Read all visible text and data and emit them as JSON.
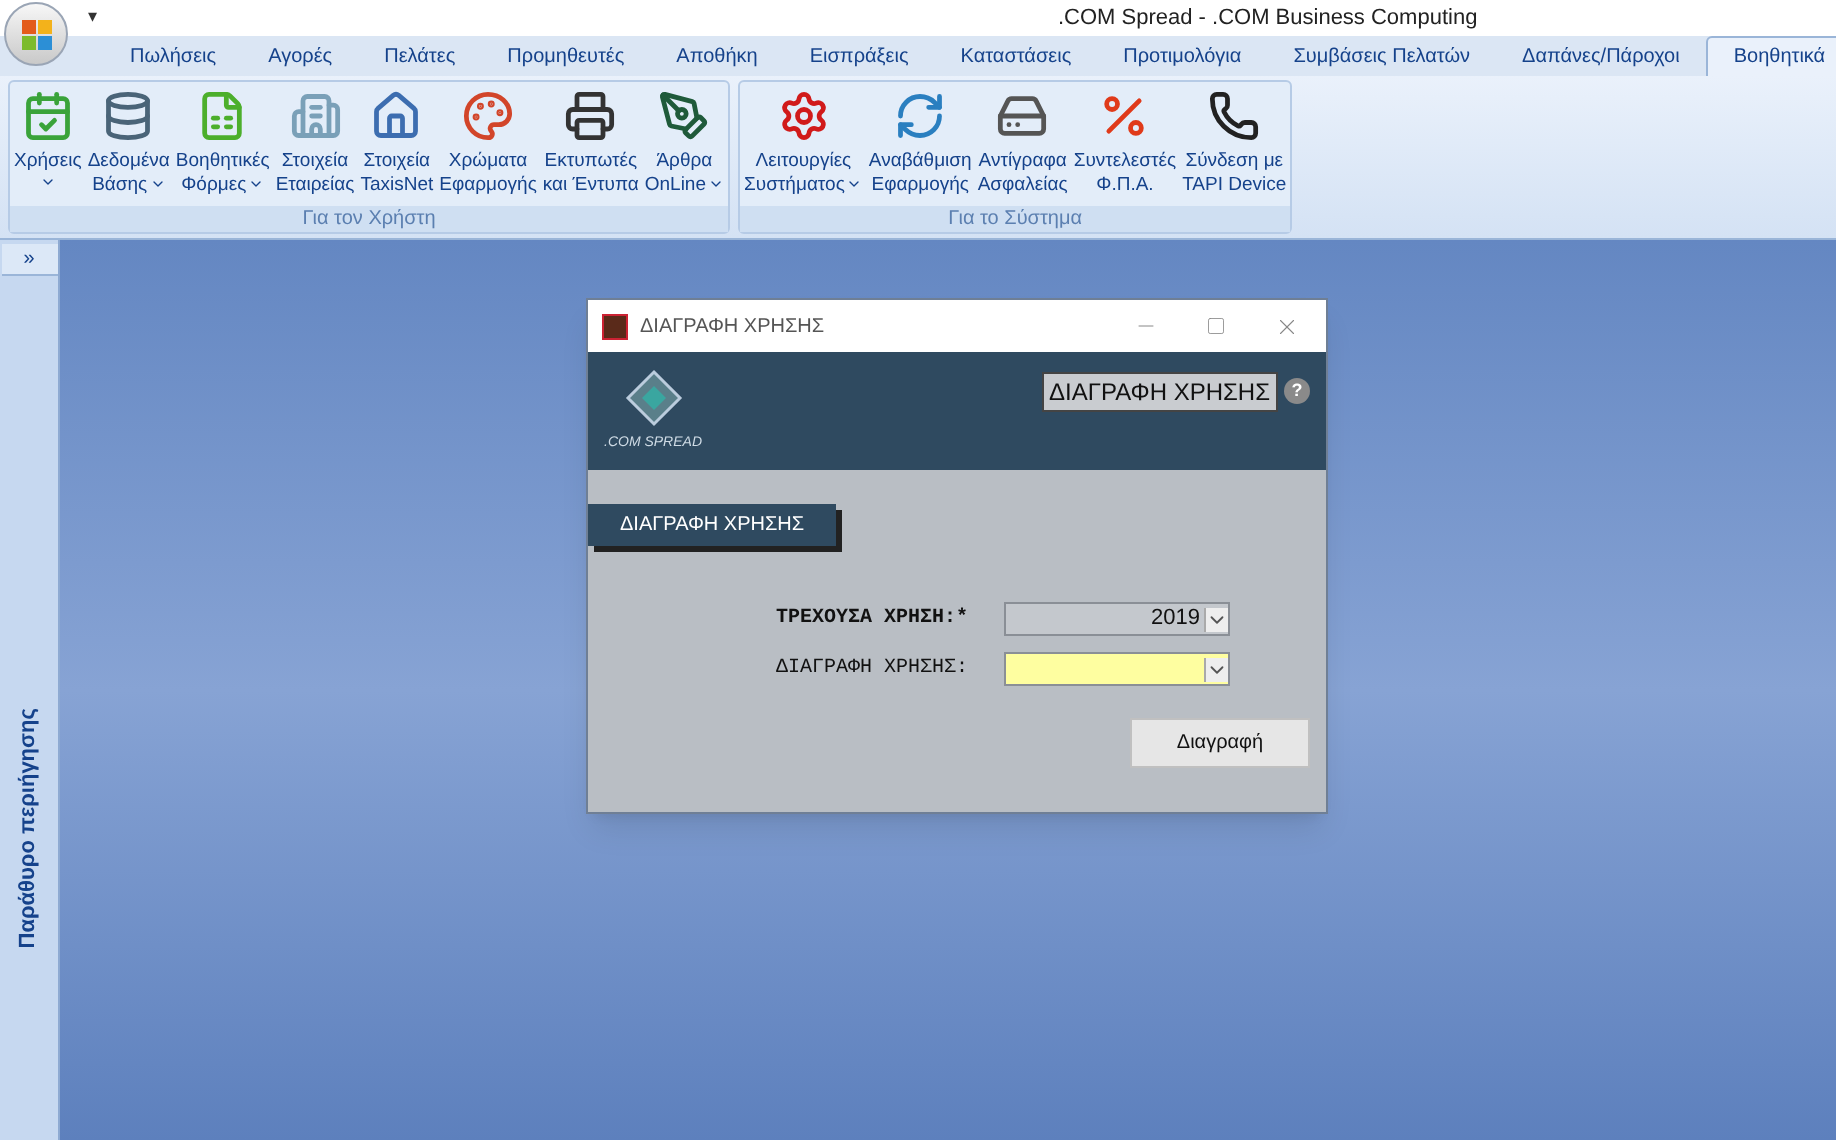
{
  "window": {
    "title": ".COM Spread - .COM Business Computing",
    "quick_access": "▾"
  },
  "tabs": [
    {
      "label": "Πωλήσεις",
      "selected": false
    },
    {
      "label": "Αγορές",
      "selected": false
    },
    {
      "label": "Πελάτες",
      "selected": false
    },
    {
      "label": "Προμηθευτές",
      "selected": false
    },
    {
      "label": "Αποθήκη",
      "selected": false
    },
    {
      "label": "Εισπράξεις",
      "selected": false
    },
    {
      "label": "Καταστάσεις",
      "selected": false
    },
    {
      "label": "Προτιμολόγια",
      "selected": false
    },
    {
      "label": "Συμβάσεις Πελατών",
      "selected": false
    },
    {
      "label": "Δαπάνες/Πάροχοι",
      "selected": false
    },
    {
      "label": "Βοηθητικά",
      "selected": true
    }
  ],
  "ribbon_groups": [
    {
      "title": "Για τον Χρήστη",
      "items": [
        {
          "kind": "calendar",
          "lines": [
            "Χρήσεις"
          ],
          "dropdown": true
        },
        {
          "kind": "database",
          "lines": [
            "Δεδομένα",
            "Βάσης"
          ],
          "dropdown": true
        },
        {
          "kind": "forms",
          "lines": [
            "Βοηθητικές",
            "Φόρμες"
          ],
          "dropdown": true
        },
        {
          "kind": "building",
          "lines": [
            "Στοιχεία",
            "Εταιρείας"
          ],
          "dropdown": false
        },
        {
          "kind": "house",
          "lines": [
            "Στοιχεία",
            "TaxisNet"
          ],
          "dropdown": false
        },
        {
          "kind": "palette",
          "lines": [
            "Χρώματα",
            "Εφαρμογής"
          ],
          "dropdown": false
        },
        {
          "kind": "printer",
          "lines": [
            "Εκτυπωτές",
            "και Έντυπα"
          ],
          "dropdown": false
        },
        {
          "kind": "pen",
          "lines": [
            "Άρθρα",
            "OnLine"
          ],
          "dropdown": true
        }
      ]
    },
    {
      "title": "Για το Σύστημα",
      "items": [
        {
          "kind": "gear",
          "lines": [
            "Λειτουργίες",
            "Συστήματος"
          ],
          "dropdown": true
        },
        {
          "kind": "update",
          "lines": [
            "Αναβάθμιση",
            "Εφαρμογής"
          ],
          "dropdown": false
        },
        {
          "kind": "drive",
          "lines": [
            "Αντίγραφα",
            "Ασφαλείας"
          ],
          "dropdown": false
        },
        {
          "kind": "percent",
          "lines": [
            "Συντελεστές",
            "Φ.Π.Α."
          ],
          "dropdown": false
        },
        {
          "kind": "phone",
          "lines": [
            "Σύνδεση με",
            "TAPI Device"
          ],
          "dropdown": false
        }
      ]
    }
  ],
  "nav_pane": {
    "expand": "»",
    "title": "Παράθυρο περιήγησης"
  },
  "dialog": {
    "title": "ΔΙΑΓΡΑΦΗ ΧΡΗΣΗΣ",
    "logo_text": ".COM SPREAD",
    "header_title": "ΔΙΑΓΡΑΦΗ ΧΡΗΣΗΣ",
    "help": "?",
    "section": "ΔΙΑΓΡΑΦΗ ΧΡΗΣΗΣ",
    "fields": [
      {
        "label": "ΤΡΕΧΟΥΣΑ ΧΡΗΣΗ:*",
        "value": "2019",
        "kind": "locked"
      },
      {
        "label": "ΔΙΑΓΡΑΦΗ ΧΡΗΣΗΣ:",
        "kind": "editable"
      }
    ],
    "button": "Διαγραφή"
  }
}
